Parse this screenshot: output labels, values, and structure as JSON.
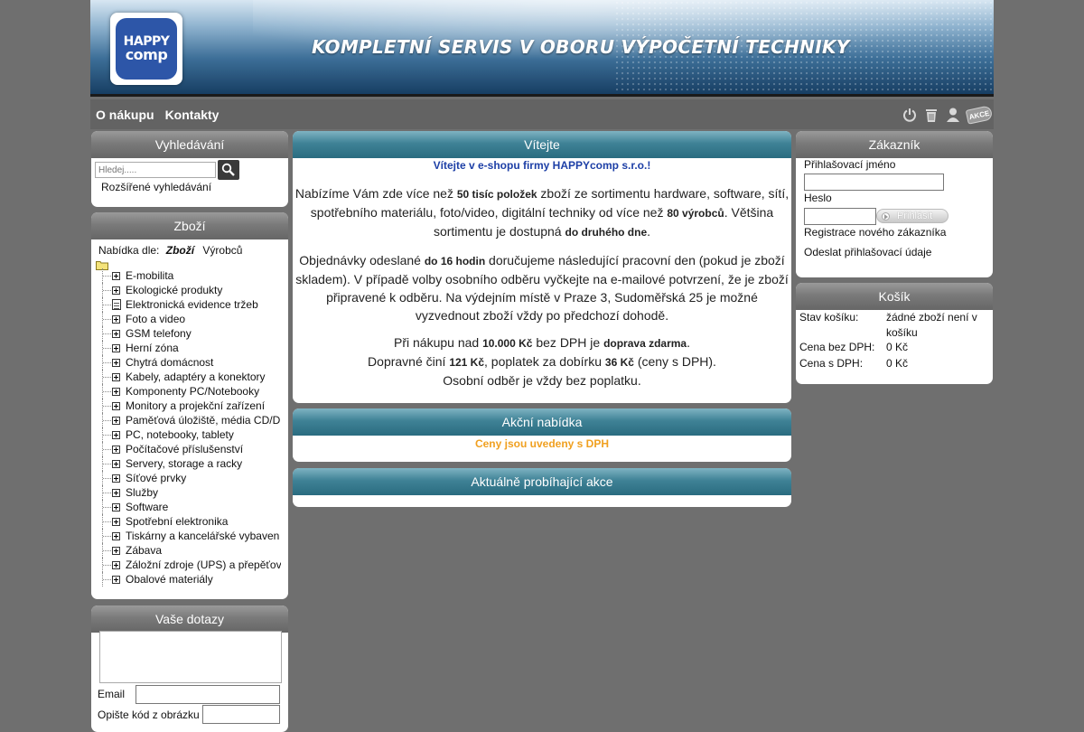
{
  "header": {
    "logo_line1": "HAPPY",
    "logo_line2": "comp",
    "slogan": "KOMPLETNÍ SERVIS V OBORU VÝPOČETNÍ TECHNIKY"
  },
  "nav": {
    "items": [
      {
        "label": "O nákupu"
      },
      {
        "label": "Kontakty"
      }
    ],
    "icons": [
      "power-icon",
      "trash-icon",
      "user-icon",
      "akce-tag-icon"
    ],
    "akce_label": "AKCE"
  },
  "search": {
    "title": "Vyhledávání",
    "placeholder": "Hledej.....",
    "advanced_link": "Rozšířené vyhledávání"
  },
  "catalog": {
    "title": "Zboží",
    "sort_label": "Nabídka dle:",
    "sort_active": "Zboží",
    "sort_alt": "Výrobců",
    "items": [
      {
        "label": "E-mobilita",
        "type": "plus"
      },
      {
        "label": "Ekologické produkty",
        "type": "plus"
      },
      {
        "label": "Elektronická evidence tržeb",
        "type": "doc"
      },
      {
        "label": "Foto a video",
        "type": "plus"
      },
      {
        "label": "GSM telefony",
        "type": "plus"
      },
      {
        "label": "Herní zóna",
        "type": "plus"
      },
      {
        "label": "Chytrá domácnost",
        "type": "plus"
      },
      {
        "label": "Kabely, adaptéry a konektory",
        "type": "plus"
      },
      {
        "label": "Komponenty PC/Notebooky",
        "type": "plus"
      },
      {
        "label": "Monitory a projekční zařízení",
        "type": "plus"
      },
      {
        "label": "Paměťová úložiště, média CD/D",
        "type": "plus"
      },
      {
        "label": "PC, notebooky, tablety",
        "type": "plus"
      },
      {
        "label": "Počítačové příslušenství",
        "type": "plus"
      },
      {
        "label": "Servery, storage a racky",
        "type": "plus"
      },
      {
        "label": "Síťové prvky",
        "type": "plus"
      },
      {
        "label": "Služby",
        "type": "plus"
      },
      {
        "label": "Software",
        "type": "plus"
      },
      {
        "label": "Spotřební elektronika",
        "type": "plus"
      },
      {
        "label": "Tiskárny a kancelářské vybaven",
        "type": "plus"
      },
      {
        "label": "Zábava",
        "type": "plus"
      },
      {
        "label": "Záložní zdroje (UPS) a přepěťov",
        "type": "plus"
      },
      {
        "label": "Obalové materiály",
        "type": "plus"
      }
    ]
  },
  "queries": {
    "title": "Vaše dotazy",
    "email_label": "Email",
    "captcha_label": "Opište kód z obrázku"
  },
  "welcome": {
    "title": "Vítejte",
    "tagline": "Vítejte v e-shopu firmy HAPPYcomp s.r.o.!",
    "p1": {
      "t1": "Nabízíme Vám zde více než ",
      "b1": "50 tisíc položek",
      "t2": " zboží ze sortimentu hardware, software, sítí, spotřebního materiálu, foto/video, digitální techniky od více než ",
      "b2": "80 výrobců",
      "t3": ". Většina sortimentu je dostupná ",
      "b3": "do druhého dne",
      "t4": "."
    },
    "p2": {
      "t1": "Objednávky odeslané ",
      "b1": "do 16 hodin",
      "t2": " doručujeme následující pracovní den (pokud je zboží skladem). V případě volby osobního odběru vyčkejte na e-mailové potvrzení, že je zboží připravené k odběru. Na výdejním místě v Praze 3, Sudoměřská 25 je možné vyzvednout zboží vždy po předchozí dohodě."
    },
    "p3": {
      "t1": "Při nákupu nad ",
      "b1": "10.000 Kč",
      "t2": " bez DPH je ",
      "b2": "doprava zdarma",
      "t3": ".",
      "t4": "Dopravné činí ",
      "b3": "121 Kč",
      "t5": ", poplatek za dobírku ",
      "b4": "36 Kč",
      "t6": " (ceny s DPH).",
      "t7": "Osobní odběr je vždy bez poplatku."
    }
  },
  "offers": {
    "title": "Akční nabídka",
    "note": "Ceny jsou uvedeny s DPH"
  },
  "promotions": {
    "title": "Aktuálně probíhající akce"
  },
  "customer": {
    "title": "Zákazník",
    "login_label": "Přihlašovací jméno",
    "password_label": "Heslo",
    "login_button": "Přihlásit",
    "register_link": "Registrace nového zákazníka",
    "send_credentials_link": "Odeslat přihlašovací údaje"
  },
  "cart": {
    "title": "Košík",
    "status_label": "Stav košíku:",
    "status_value": "žádné zboží není v košíku",
    "price_net_label": "Cena bez DPH:",
    "price_net_value": "0 Kč",
    "price_gross_label": "Cena s DPH:",
    "price_gross_value": "0 Kč"
  },
  "colors": {
    "teal_header": "#3f8296",
    "gray_header": "#7a7a7a",
    "tagline_blue": "#1d3fa6",
    "orange_note": "#f0a020",
    "background": "#6f6f6f"
  }
}
